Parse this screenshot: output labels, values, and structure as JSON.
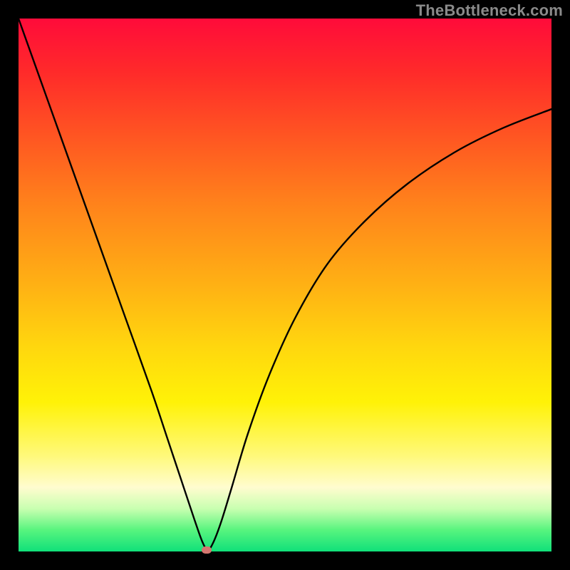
{
  "watermark": "TheBottleneck.com",
  "chart_data": {
    "type": "line",
    "title": "",
    "xlabel": "",
    "ylabel": "",
    "xlim": [
      0,
      100
    ],
    "ylim": [
      0,
      100
    ],
    "grid": false,
    "legend": false,
    "series": [
      {
        "name": "curve",
        "x": [
          0,
          5,
          10,
          15,
          20,
          25,
          28,
          31,
          33,
          34.5,
          35.5,
          36.5,
          38,
          40,
          43,
          47,
          52,
          58,
          65,
          73,
          82,
          91,
          100
        ],
        "y": [
          100,
          86,
          72,
          58,
          44,
          30,
          21,
          12,
          6,
          1.8,
          0.3,
          1.6,
          5.5,
          12,
          22,
          33,
          44,
          54,
          62,
          69,
          75,
          79.5,
          83
        ],
        "color": "#000000"
      }
    ],
    "marker": {
      "x": 35.3,
      "y": 0.3,
      "color": "#d4766f"
    },
    "background_gradient": {
      "top": "#ff0b3a",
      "bottom": "#10e07a"
    }
  }
}
